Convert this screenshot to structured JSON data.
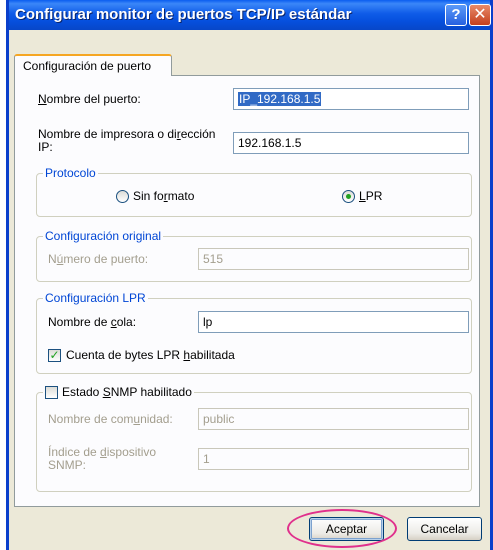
{
  "window": {
    "title": "Configurar monitor de puertos TCP/IP estándar",
    "help_glyph": "?",
    "close_glyph": "✕"
  },
  "tab": {
    "label": "Configuración de puerto"
  },
  "port_name": {
    "label": "Nombre del puerto:",
    "value": "IP_192.168.1.5"
  },
  "printer_address": {
    "label": "Nombre de impresora o dirección IP:",
    "value": "192.168.1.5"
  },
  "protocol": {
    "title": "Protocolo",
    "options": [
      {
        "label": "Sin formato",
        "selected": false
      },
      {
        "label": "LPR",
        "selected": true
      }
    ]
  },
  "original_config": {
    "title": "Configuración original",
    "port_number_label": "Número de puerto:",
    "port_number_value": "515"
  },
  "lpr_config": {
    "title": "Configuración LPR",
    "queue_label": "Nombre de cola:",
    "queue_value": "lp",
    "byte_count_label": "Cuenta de bytes LPR habilitada",
    "byte_count_checked": true
  },
  "snmp": {
    "title": "Estado SNMP habilitado",
    "checked": false,
    "community_label": "Nombre de comunidad:",
    "community_value": "public",
    "device_index_label": "Índice de dispositivo SNMP:",
    "device_index_value": "1"
  },
  "buttons": {
    "ok": "Aceptar",
    "cancel": "Cancelar"
  },
  "colors": {
    "title_bar": "#0A5DF0",
    "group_title": "#0046D5",
    "highlight": "#E0308C"
  }
}
